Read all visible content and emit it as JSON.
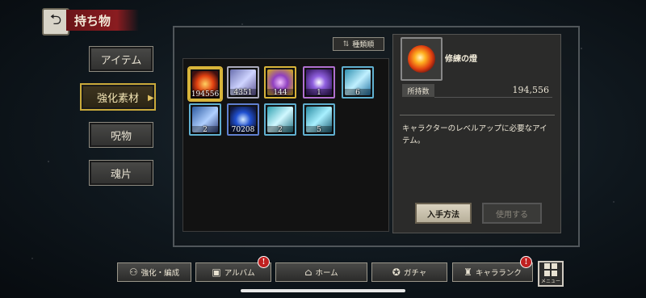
{
  "header": {
    "title": "持ち物"
  },
  "tabs": [
    {
      "label": "アイテム",
      "active": false
    },
    {
      "label": "強化素材",
      "active": true
    },
    {
      "label": "呪物",
      "active": false
    },
    {
      "label": "魂片",
      "active": false
    }
  ],
  "sort_label": "種類順",
  "items": [
    {
      "name": "fire-orb",
      "count": "194556",
      "selected": true,
      "color": "#e04010"
    },
    {
      "name": "purple-crystal",
      "count": "4351",
      "selected": false,
      "color": "#7060d0"
    },
    {
      "name": "purple-shard-gold",
      "count": "144",
      "selected": false,
      "color": "#c9a030"
    },
    {
      "name": "spiky-crystal",
      "count": "1",
      "selected": false,
      "color": "#8040c0"
    },
    {
      "name": "blue-feather",
      "count": "6",
      "selected": false,
      "color": "#40a0c0"
    },
    {
      "name": "rune-block",
      "count": "2",
      "selected": false,
      "color": "#3070c0"
    },
    {
      "name": "blue-orb",
      "count": "70208",
      "selected": false,
      "color": "#2050d0"
    },
    {
      "name": "cyan-tile",
      "count": "2",
      "selected": false,
      "color": "#30a0b0"
    },
    {
      "name": "cyan-gem",
      "count": "5",
      "selected": false,
      "color": "#30a0b0"
    }
  ],
  "detail": {
    "name": "修練の燈",
    "owned_label": "所持数",
    "owned_value": "194,556",
    "description": "キャラクターのレベルアップに必要なアイテム。",
    "acquire_label": "入手方法",
    "use_label": "使用する"
  },
  "nav": [
    {
      "label": "強化・編成",
      "icon": "upgrade-icon",
      "badge": false
    },
    {
      "label": "アルバム",
      "icon": "album-icon",
      "badge": true
    },
    {
      "label": "ホーム",
      "icon": "home-icon",
      "badge": false
    },
    {
      "label": "ガチャ",
      "icon": "gacha-icon",
      "badge": false
    },
    {
      "label": "キャラランク",
      "icon": "rank-icon",
      "badge": true
    }
  ],
  "menu_label": "メニュー"
}
